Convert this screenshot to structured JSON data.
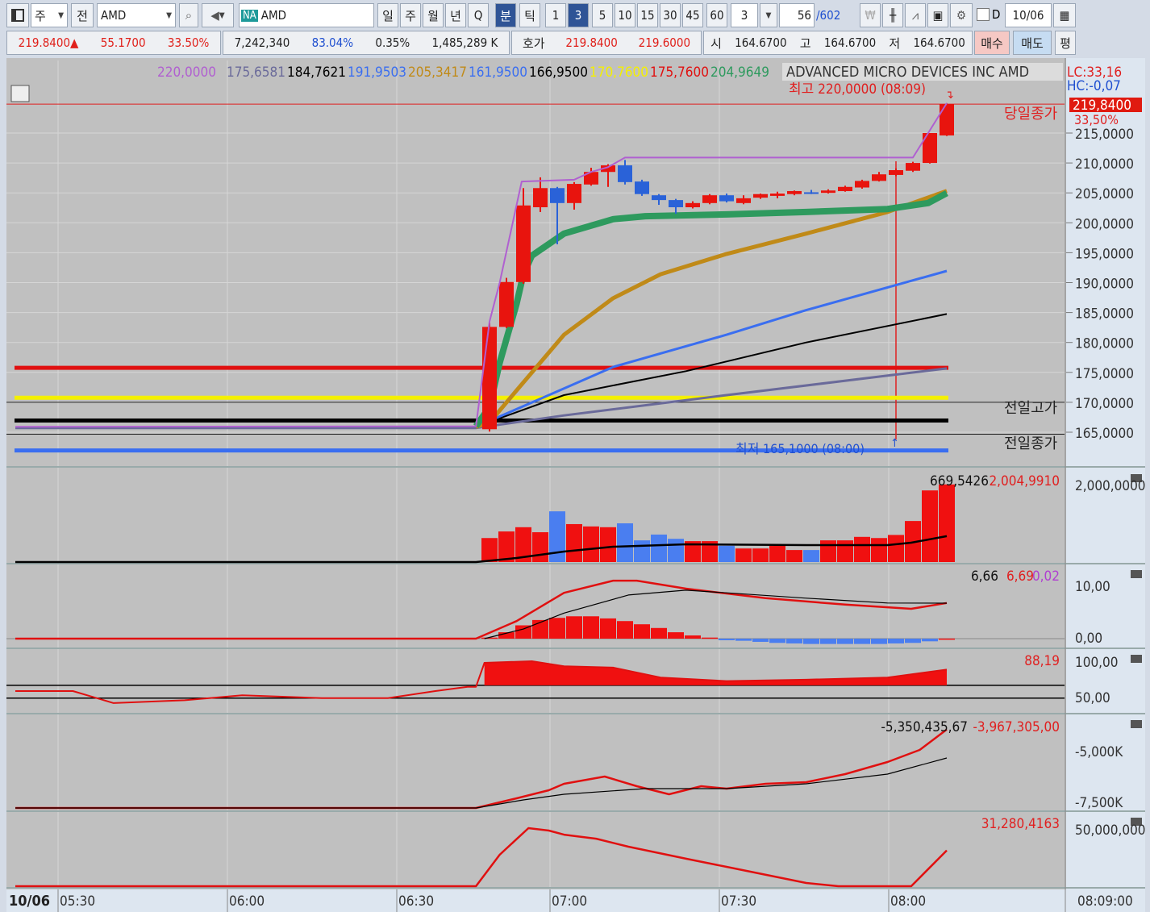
{
  "toolbar": {
    "market_select": "주",
    "all_label": "전",
    "symbol": "AMD",
    "exchange_badge": "NA",
    "symbol_name": "AMD",
    "periods": [
      "일",
      "주",
      "월",
      "년",
      "Q",
      "분",
      "틱"
    ],
    "intervals": [
      "1",
      "3",
      "5",
      "10",
      "15",
      "30",
      "45",
      "60"
    ],
    "custom_interval": "3",
    "count_current": "56",
    "count_total": "/602",
    "d_label": "D",
    "date": "10/06"
  },
  "quote": {
    "price": "219.8400▲",
    "change": "55.1700",
    "change_pct": "33.50%",
    "volume": "7,242,340",
    "volume_ratio": "83.04%",
    "turnover": "0.35%",
    "amount": "1,485,289 K",
    "hoga_label": "호가",
    "ask": "219.8400",
    "bid": "219.6000",
    "open_label": "시",
    "open": "164.6700",
    "high_label": "고",
    "high": "164.6700",
    "low_label": "저",
    "low": "164.6700",
    "buy": "매수",
    "sell": "매도",
    "avg": "평"
  },
  "legend": {
    "values": [
      {
        "text": "220,0000",
        "color": "#b060d0"
      },
      {
        "text": "175,6581",
        "color": "#6a6a9a"
      },
      {
        "text": "184,7621",
        "color": "#000000"
      },
      {
        "text": "191,9503",
        "color": "#3a6ef0"
      },
      {
        "text": "205,3417",
        "color": "#c08a18"
      },
      {
        "text": "161,9500",
        "color": "#3a6ef0"
      },
      {
        "text": "166,9500",
        "color": "#000000"
      },
      {
        "text": "170,7600",
        "color": "#f4f000"
      },
      {
        "text": "175,7600",
        "color": "#e01010"
      },
      {
        "text": "204,9649",
        "color": "#2e9a5e"
      }
    ],
    "title": "ADVANCED MICRO DEVICES INC  AMD",
    "lc": "LC:33,16",
    "hc": "HC:-0,07"
  },
  "annotations": {
    "high": "최고 220,0000 (08:09)",
    "low": "최저 165,1000 (08:00)",
    "today_close": "당일종가",
    "prev_high": "전일고가",
    "prev_close": "전일종가",
    "current_price": "219,8400",
    "current_pct": "33,50%"
  },
  "panels": {
    "volume": {
      "labels": [
        "669,5426",
        "2,004,9910"
      ],
      "axis": [
        "2,000,0000"
      ]
    },
    "macd": {
      "labels": [
        "6,66",
        "6,69",
        "0,02"
      ],
      "axis": [
        "10,00",
        "0,00"
      ]
    },
    "stoch": {
      "labels": [
        "88,19"
      ],
      "axis": [
        "100,00",
        "50,00"
      ]
    },
    "obv": {
      "labels": [
        "-5,350,435,67",
        "-3,967,305,00"
      ],
      "axis": [
        "-5,000K",
        "-7,500K"
      ]
    },
    "osc": {
      "labels": [
        "31,280,4163"
      ],
      "axis": [
        "50,000,000"
      ]
    }
  },
  "time_axis": {
    "date": "10/06",
    "ticks": [
      "05:30",
      "06:00",
      "06:30",
      "07:00",
      "07:30",
      "08:00"
    ],
    "cursor_time": "08:09:00"
  },
  "colors": {
    "up": "#e8140e",
    "down": "#2a62d8",
    "bg": "#c0c0c0",
    "axis_bg": "#dde6f0"
  },
  "chart_data": {
    "type": "candlestick",
    "interval": "3 min",
    "price_axis": {
      "ticks": [
        215,
        210,
        205,
        200,
        195,
        190,
        185,
        180,
        175,
        170,
        165
      ],
      "tick_labels": [
        "215,0000",
        "210,0000",
        "205,0000",
        "200,0000",
        "195,0000",
        "190,0000",
        "185,0000",
        "180,0000",
        "175,0000",
        "170,0000",
        "165,0000"
      ]
    },
    "candles_ohlc": [
      [
        165.5,
        183.3,
        165.1,
        182.6
      ],
      [
        182.6,
        190.8,
        182.4,
        190.1
      ],
      [
        190.1,
        205.8,
        189.8,
        202.9
      ],
      [
        202.6,
        207.6,
        201.8,
        205.8
      ],
      [
        205.8,
        206.0,
        196.4,
        203.3
      ],
      [
        203.3,
        206.8,
        202.2,
        206.5
      ],
      [
        206.4,
        209.2,
        206.2,
        208.5
      ],
      [
        208.5,
        209.8,
        206.0,
        209.6
      ],
      [
        209.6,
        210.5,
        206.4,
        206.8
      ],
      [
        206.9,
        207.2,
        204.5,
        204.8
      ],
      [
        204.6,
        204.8,
        203.0,
        203.8
      ],
      [
        203.8,
        204.0,
        201.5,
        202.6
      ],
      [
        202.6,
        203.6,
        202.4,
        203.3
      ],
      [
        203.3,
        204.8,
        203.1,
        204.6
      ],
      [
        204.6,
        204.9,
        203.4,
        203.6
      ],
      [
        203.3,
        204.6,
        203.1,
        204.1
      ],
      [
        204.2,
        204.9,
        204.0,
        204.8
      ],
      [
        204.5,
        205.2,
        204.1,
        204.9
      ],
      [
        204.8,
        205.4,
        204.6,
        205.3
      ],
      [
        205.1,
        205.5,
        204.8,
        205.0
      ],
      [
        205.0,
        205.6,
        204.9,
        205.4
      ],
      [
        205.3,
        206.2,
        205.2,
        206.0
      ],
      [
        205.9,
        207.2,
        205.7,
        207.0
      ],
      [
        207.0,
        208.5,
        206.9,
        208.1
      ],
      [
        208.0,
        209.1,
        207.8,
        208.8
      ],
      [
        208.7,
        210.2,
        208.5,
        210.0
      ],
      [
        210.0,
        215.0,
        209.9,
        215.0
      ],
      [
        214.6,
        220.0,
        214.5,
        219.84
      ]
    ],
    "overlays": [
      {
        "name": "highest-high",
        "color": "#b060d0",
        "width": 2,
        "points": [
          [
            -28,
            165.9
          ],
          [
            -0.8,
            166
          ],
          [
            0,
            183.5
          ],
          [
            0.6,
            190
          ],
          [
            1.9,
            206.9
          ],
          [
            5,
            207.2
          ],
          [
            6,
            208.5
          ],
          [
            7,
            209.3
          ],
          [
            8,
            210.9
          ],
          [
            25,
            210.9
          ],
          [
            27,
            220
          ]
        ]
      },
      {
        "name": "ma-green",
        "color": "#2e9a5e",
        "width": 8,
        "points": [
          [
            -0.8,
            166
          ],
          [
            0,
            169.2
          ],
          [
            0.6,
            176.6
          ],
          [
            1.6,
            186.5
          ],
          [
            2,
            191.4
          ],
          [
            2.5,
            194.5
          ],
          [
            4.4,
            198.2
          ],
          [
            7.3,
            200.6
          ],
          [
            9.2,
            201.1
          ],
          [
            14,
            201.4
          ],
          [
            18.7,
            201.8
          ],
          [
            23.5,
            202.3
          ],
          [
            25.9,
            203.3
          ],
          [
            27,
            204.96
          ]
        ]
      },
      {
        "name": "ma-gold",
        "color": "#c08a18",
        "width": 5,
        "points": [
          [
            -0.8,
            165.9
          ],
          [
            0,
            166.6
          ],
          [
            1.6,
            172
          ],
          [
            4.4,
            181.3
          ],
          [
            7.3,
            187.4
          ],
          [
            10.1,
            191.4
          ],
          [
            14,
            194.8
          ],
          [
            18.7,
            198.2
          ],
          [
            23.5,
            201.8
          ],
          [
            27,
            205.34
          ]
        ]
      },
      {
        "name": "ma-blue",
        "color": "#3a6ef0",
        "width": 3,
        "points": [
          [
            -0.8,
            165.9
          ],
          [
            3.5,
            171.2
          ],
          [
            7.3,
            175.9
          ],
          [
            14,
            181.3
          ],
          [
            18.7,
            185.4
          ],
          [
            27,
            191.95
          ]
        ]
      },
      {
        "name": "ma-black",
        "color": "#000000",
        "width": 2,
        "points": [
          [
            -0.8,
            165.9
          ],
          [
            4.4,
            171.2
          ],
          [
            11.6,
            175.2
          ],
          [
            18.7,
            180
          ],
          [
            27,
            184.76
          ]
        ]
      },
      {
        "name": "ma-gray",
        "color": "#6a6a9a",
        "width": 3,
        "points": [
          [
            -28,
            165.7
          ],
          [
            -0.8,
            165.7
          ],
          [
            4.4,
            167.8
          ],
          [
            14,
            171.2
          ],
          [
            27,
            175.66
          ]
        ]
      }
    ],
    "hlines": [
      {
        "value": 175.76,
        "color": "#e01010"
      },
      {
        "value": 170.76,
        "color": "#f4f000"
      },
      {
        "value": 166.95,
        "color": "#000000"
      },
      {
        "value": 161.95,
        "color": "#3a6ef0"
      }
    ],
    "reference_lines": {
      "today_close": 219.84,
      "prev_high": 170.0,
      "prev_close": 164.67
    },
    "volume": [
      620000,
      790000,
      900000,
      770000,
      1310000,
      980000,
      920000,
      900000,
      1000000,
      560000,
      710000,
      600000,
      540000,
      540000,
      420000,
      350000,
      350000,
      420000,
      310000,
      310000,
      560000,
      560000,
      650000,
      620000,
      700000,
      1060000,
      1850000,
      2004991
    ],
    "volume_ma": [
      [
        -28,
        0
      ],
      [
        -0.8,
        0
      ],
      [
        1.6,
        104000
      ],
      [
        4.4,
        271000
      ],
      [
        7.3,
        396000
      ],
      [
        11.6,
        458000
      ],
      [
        18.7,
        437000
      ],
      [
        23.5,
        437000
      ],
      [
        24.9,
        500000
      ],
      [
        27,
        669543
      ]
    ],
    "macd": [
      [
        -28,
        0
      ],
      [
        -0.8,
        0
      ],
      [
        1.6,
        3.3
      ],
      [
        4.4,
        8.6
      ],
      [
        7.3,
        10.9
      ],
      [
        8.7,
        10.9
      ],
      [
        11.6,
        9.4
      ],
      [
        16.3,
        7.6
      ],
      [
        21,
        6.4
      ],
      [
        24.9,
        5.6
      ],
      [
        27,
        6.69
      ]
    ],
    "macd_signal": [
      [
        -0.3,
        0
      ],
      [
        2,
        1.8
      ],
      [
        4.4,
        4.8
      ],
      [
        8.2,
        8.2
      ],
      [
        11.6,
        9.1
      ],
      [
        14,
        8.6
      ],
      [
        18.7,
        7.6
      ],
      [
        23.5,
        6.7
      ],
      [
        27,
        6.66
      ]
    ],
    "macd_hist": [
      0.2,
      1.2,
      2.5,
      3.5,
      3.9,
      4.2,
      4.2,
      3.8,
      3.3,
      2.7,
      2.0,
      1.2,
      0.6,
      0.2,
      -0.3,
      -0.4,
      -0.6,
      -0.8,
      -0.9,
      -1.0,
      -1.0,
      -1.0,
      -1.0,
      -1.0,
      -0.9,
      -0.8,
      -0.5,
      0.02
    ],
    "stoch": [
      [
        -28,
        58
      ],
      [
        -24.6,
        58
      ],
      [
        -22.2,
        41
      ],
      [
        -18,
        45
      ],
      [
        -14.6,
        52
      ],
      [
        -9.9,
        48
      ],
      [
        -6,
        48
      ],
      [
        -3.2,
        58
      ],
      [
        -1.3,
        64
      ],
      [
        -0.8,
        64
      ],
      [
        -0.3,
        97.7
      ],
      [
        2.5,
        100
      ],
      [
        4.4,
        93
      ],
      [
        7.3,
        91
      ],
      [
        10.1,
        77
      ],
      [
        14,
        72
      ],
      [
        18.7,
        74
      ],
      [
        23.5,
        77
      ],
      [
        27,
        88.19
      ]
    ],
    "stoch_levels": [
      66,
      48
    ],
    "obv": [
      [
        -28,
        -7773
      ],
      [
        -0.8,
        -7773
      ],
      [
        1.6,
        -7305
      ],
      [
        3.5,
        -6914
      ],
      [
        4.4,
        -6602
      ],
      [
        6.8,
        -6250
      ],
      [
        8.7,
        -6719
      ],
      [
        10.6,
        -7109
      ],
      [
        12.5,
        -6719
      ],
      [
        14,
        -6836
      ],
      [
        16.3,
        -6602
      ],
      [
        18.7,
        -6523
      ],
      [
        21,
        -6133
      ],
      [
        23.5,
        -5547
      ],
      [
        25.4,
        -4961
      ],
      [
        27,
        -3967
      ]
    ],
    "obv_signal": [
      [
        -28,
        -7773
      ],
      [
        -0.8,
        -7773
      ],
      [
        2,
        -7383
      ],
      [
        4.4,
        -7109
      ],
      [
        9.2,
        -6836
      ],
      [
        14,
        -6836
      ],
      [
        18.7,
        -6602
      ],
      [
        23.5,
        -6133
      ],
      [
        27,
        -5350
      ]
    ],
    "osc": [
      [
        -28,
        0
      ],
      [
        -0.8,
        0
      ],
      [
        0.6,
        27500000
      ],
      [
        2.3,
        50700000
      ],
      [
        3.5,
        48600000
      ],
      [
        4.4,
        45000000
      ],
      [
        6.3,
        41500000
      ],
      [
        8.2,
        34500000
      ],
      [
        11.6,
        24000000
      ],
      [
        14,
        16900000
      ],
      [
        18.7,
        2800000
      ],
      [
        20.6,
        0
      ],
      [
        24.9,
        0
      ],
      [
        27,
        31280416
      ]
    ]
  }
}
